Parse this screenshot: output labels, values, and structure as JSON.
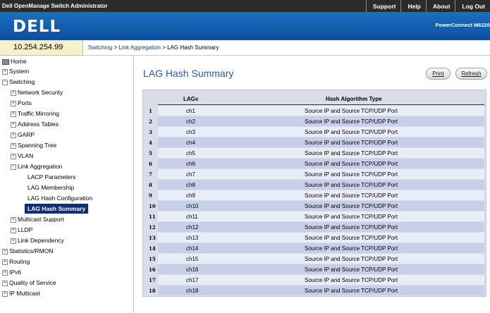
{
  "topbar": {
    "app_title": "Dell OpenManage Switch Administrator",
    "links": [
      "Support",
      "Help",
      "About",
      "Log Out"
    ]
  },
  "brand": {
    "logo": "DELL",
    "model": "PowerConnect M6220"
  },
  "ip_address": "10.254.254.99",
  "breadcrumb": {
    "level1": "Switching",
    "sep1": " > ",
    "level2": "Link Aggregation",
    "sep2": " > ",
    "current": "LAG Hash Summary"
  },
  "nav": {
    "home": "Home",
    "system": "System",
    "switching": "Switching",
    "network_security": "Network Security",
    "ports": "Ports",
    "traffic_mirroring": "Traffic Mirroring",
    "address_tables": "Address Tables",
    "garp": "GARP",
    "spanning_tree": "Spanning Tree",
    "vlan": "VLAN",
    "link_aggregation": "Link Aggregation",
    "lacp_parameters": "LACP Parameters",
    "lag_membership": "LAG Membership",
    "lag_hash_configuration": "LAG Hash Configuration",
    "lag_hash_summary": "LAG Hash Summary",
    "multicast_support": "Multicast Support",
    "lldp": "LLDP",
    "link_dependency": "Link Dependency",
    "statistics_rmon": "Statistics/RMON",
    "routing": "Routing",
    "ipv6": "IPv6",
    "qos": "Quality of Service",
    "ip_multicast": "IP Multicast",
    "expand_symbol": "+",
    "collapse_symbol": "−"
  },
  "page": {
    "title": "LAG Hash Summary",
    "print_label": "Print",
    "refresh_label": "Refresh"
  },
  "table": {
    "headers": {
      "lags": "LAGs",
      "hash": "Hash Algorithm Type"
    },
    "rows": [
      {
        "num": "1",
        "lag": "ch1",
        "hash": "Source IP and Source TCP/UDP Port"
      },
      {
        "num": "2",
        "lag": "ch2",
        "hash": "Source IP and Source TCP/UDP Port"
      },
      {
        "num": "3",
        "lag": "ch3",
        "hash": "Source IP and Source TCP/UDP Port"
      },
      {
        "num": "4",
        "lag": "ch4",
        "hash": "Source IP and Source TCP/UDP Port"
      },
      {
        "num": "5",
        "lag": "ch5",
        "hash": "Source IP and Source TCP/UDP Port"
      },
      {
        "num": "6",
        "lag": "ch6",
        "hash": "Source IP and Source TCP/UDP Port"
      },
      {
        "num": "7",
        "lag": "ch7",
        "hash": "Source IP and Source TCP/UDP Port"
      },
      {
        "num": "8",
        "lag": "ch8",
        "hash": "Source IP and Source TCP/UDP Port"
      },
      {
        "num": "9",
        "lag": "ch9",
        "hash": "Source IP and Source TCP/UDP Port"
      },
      {
        "num": "10",
        "lag": "ch10",
        "hash": "Source IP and Source TCP/UDP Port"
      },
      {
        "num": "11",
        "lag": "ch11",
        "hash": "Source IP and Source TCP/UDP Port"
      },
      {
        "num": "12",
        "lag": "ch12",
        "hash": "Source IP and Source TCP/UDP Port"
      },
      {
        "num": "13",
        "lag": "ch13",
        "hash": "Source IP and Source TCP/UDP Port"
      },
      {
        "num": "14",
        "lag": "ch14",
        "hash": "Source IP and Source TCP/UDP Port"
      },
      {
        "num": "15",
        "lag": "ch15",
        "hash": "Source IP and Source TCP/UDP Port"
      },
      {
        "num": "16",
        "lag": "ch16",
        "hash": "Source IP and Source TCP/UDP Port"
      },
      {
        "num": "17",
        "lag": "ch17",
        "hash": "Source IP and Source TCP/UDP Port"
      },
      {
        "num": "18",
        "lag": "ch18",
        "hash": "Source IP and Source TCP/UDP Port"
      }
    ]
  },
  "colors": {
    "brand_blue": "#0d4f9e",
    "title_blue": "#2c5aa5",
    "selected_nav": "#0b2f7a",
    "row_light": "#e8edf7",
    "row_dark": "#c7d0e8"
  }
}
